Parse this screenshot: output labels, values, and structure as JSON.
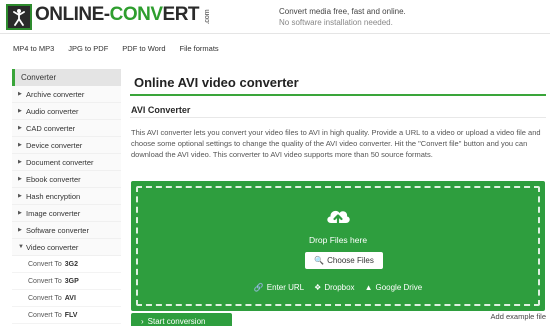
{
  "header": {
    "logo_left": "ONLINE-",
    "logo_accent": "CONV",
    "logo_right": "ERT",
    "logo_com": ".com",
    "tagline_1": "Convert media free, fast and online.",
    "tagline_2": "No software installation needed."
  },
  "topnav": [
    "MP4 to MP3",
    "JPG to PDF",
    "PDF to Word",
    "File formats"
  ],
  "sidebar": {
    "heading": "Converter",
    "items": [
      "Archive converter",
      "Audio converter",
      "CAD converter",
      "Device converter",
      "Document converter",
      "Ebook converter",
      "Hash encryption",
      "Image converter",
      "Software converter",
      "Video converter"
    ],
    "sub_prefix": "Convert To",
    "sub_items": [
      "3G2",
      "3GP",
      "AVI",
      "FLV"
    ]
  },
  "main": {
    "title": "Online AVI video converter",
    "section": "AVI Converter",
    "description": "This AVI converter lets you convert your video files to AVI in high quality. Provide a URL to a video or upload a video file and choose some optional settings to change the quality of the AVI video converter. Hit the \"Convert file\" button and you can download the AVI video. This converter to AVI video supports more than 50 source formats.",
    "drop_label": "Drop Files here",
    "choose_label": "Choose Files",
    "sources": [
      "Enter URL",
      "Dropbox",
      "Google Drive"
    ],
    "start_label": "Start conversion",
    "example_label": "Add example file"
  },
  "colors": {
    "accent": "#2e9e3e",
    "logo_dark": "#2a2a2a"
  }
}
